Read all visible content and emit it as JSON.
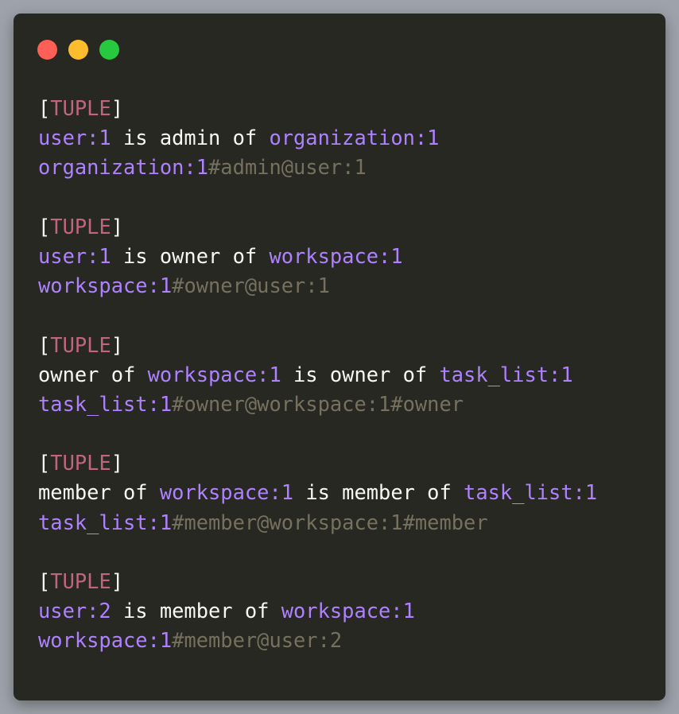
{
  "window": {
    "controls": [
      {
        "name": "close",
        "color": "#ff5f56"
      },
      {
        "name": "minimize",
        "color": "#ffbd2e"
      },
      {
        "name": "zoom",
        "color": "#27c93f"
      }
    ]
  },
  "colors": {
    "background": "#272822",
    "bracket": "#f8f8f2",
    "keyword": "#c1657f",
    "identifier": "#ae81ff",
    "text": "#f8f8f2",
    "comment": "#75715e"
  },
  "tuples": [
    {
      "open": "[",
      "label": "TUPLE",
      "close": "]",
      "statement": [
        {
          "t": "user:1",
          "k": "id"
        },
        {
          "t": " is admin of ",
          "k": "tx"
        },
        {
          "t": "organization:1",
          "k": "id"
        }
      ],
      "notation": [
        {
          "t": "organization:1",
          "k": "id"
        },
        {
          "t": "#admin@user:1",
          "k": "cm"
        }
      ]
    },
    {
      "open": "[",
      "label": "TUPLE",
      "close": "]",
      "statement": [
        {
          "t": "user:1",
          "k": "id"
        },
        {
          "t": " is owner of ",
          "k": "tx"
        },
        {
          "t": "workspace:1",
          "k": "id"
        }
      ],
      "notation": [
        {
          "t": "workspace:1",
          "k": "id"
        },
        {
          "t": "#owner@user:1",
          "k": "cm"
        }
      ]
    },
    {
      "open": "[",
      "label": "TUPLE",
      "close": "]",
      "statement": [
        {
          "t": "owner of ",
          "k": "tx"
        },
        {
          "t": "workspace:1",
          "k": "id"
        },
        {
          "t": " is owner of ",
          "k": "tx"
        },
        {
          "t": "task_list:1",
          "k": "id"
        }
      ],
      "notation": [
        {
          "t": "task_list:1",
          "k": "id"
        },
        {
          "t": "#owner@workspace:1#owner",
          "k": "cm"
        }
      ]
    },
    {
      "open": "[",
      "label": "TUPLE",
      "close": "]",
      "statement": [
        {
          "t": "member of ",
          "k": "tx"
        },
        {
          "t": "workspace:1",
          "k": "id"
        },
        {
          "t": " is member of ",
          "k": "tx"
        },
        {
          "t": "task_list:1",
          "k": "id"
        }
      ],
      "notation": [
        {
          "t": "task_list:1",
          "k": "id"
        },
        {
          "t": "#member@workspace:1#member",
          "k": "cm"
        }
      ]
    },
    {
      "open": "[",
      "label": "TUPLE",
      "close": "]",
      "statement": [
        {
          "t": "user:2",
          "k": "id"
        },
        {
          "t": " is member of ",
          "k": "tx"
        },
        {
          "t": "workspace:1",
          "k": "id"
        }
      ],
      "notation": [
        {
          "t": "workspace:1",
          "k": "id"
        },
        {
          "t": "#member@user:2",
          "k": "cm"
        }
      ]
    }
  ]
}
